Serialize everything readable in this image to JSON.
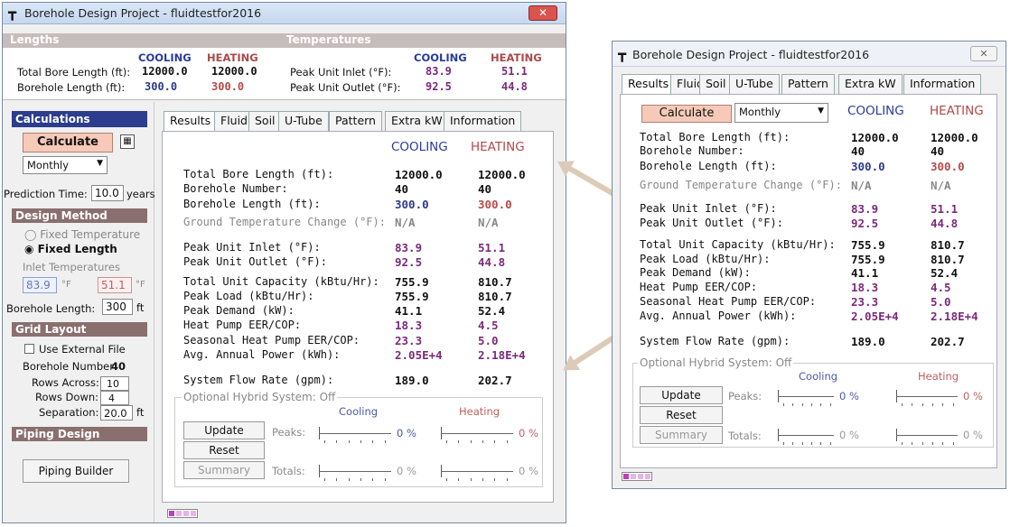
{
  "left": {
    "title": "Borehole Design Project - fluidtestfor2016",
    "lengths_header": "Lengths",
    "temps_header": "Temperatures",
    "cooling": "COOLING",
    "heating": "HEATING",
    "lengths": [
      {
        "label": "Total Bore Length (ft):",
        "cool": "12000.0",
        "heat": "12000.0"
      },
      {
        "label": "Borehole Length (ft):",
        "cool": "300.0",
        "heat": "300.0"
      }
    ],
    "temps": [
      {
        "label": "Peak Unit Inlet (°F):",
        "cool": "83.9",
        "heat": "51.1"
      },
      {
        "label": "Peak Unit Outlet (°F):",
        "cool": "92.5",
        "heat": "44.8"
      }
    ],
    "calc_header": "Calculations",
    "calculate": "Calculate",
    "period": "Monthly",
    "prediction_label": "Prediction Time:",
    "prediction_value": "10.0",
    "prediction_unit": "years",
    "design_header": "Design Method",
    "fixed_temp": "Fixed Temperature",
    "fixed_length": "Fixed Length",
    "inlet_label": "Inlet Temperatures",
    "inlet_cool": "83.9",
    "inlet_heat": "51.1",
    "unit_f": "°F",
    "bore_len_label": "Borehole Length:",
    "bore_len_value": "300",
    "ft": "ft",
    "grid_header": "Grid Layout",
    "use_external": "Use External File",
    "bore_num_label": "Borehole Number:",
    "bore_num_value": "40",
    "rows_across_label": "Rows Across:",
    "rows_across_value": "10",
    "rows_down_label": "Rows Down:",
    "rows_down_value": "4",
    "separation_label": "Separation:",
    "separation_value": "20.0",
    "piping_header": "Piping Design",
    "piping_builder": "Piping Builder"
  },
  "tabs": [
    "Results",
    "Fluid",
    "Soil",
    "U-Tube",
    "Pattern",
    "Extra kW",
    "Information"
  ],
  "results": [
    {
      "label": "Total Bore Length (ft):",
      "cool": "12000.0",
      "heat": "12000.0",
      "cc": "vk",
      "hc": "vk"
    },
    {
      "label": "Borehole Number:",
      "cool": "40",
      "heat": "40",
      "cc": "vk",
      "hc": "vk"
    },
    {
      "label": "Borehole Length (ft):",
      "cool": "300.0",
      "heat": "300.0",
      "cc": "vb",
      "hc": "vr"
    },
    {
      "label": "Ground Temperature Change (°F):",
      "cool": "N/A",
      "heat": "N/A",
      "cc": "vg",
      "hc": "vg",
      "grey": true
    },
    {
      "label": "Peak Unit Inlet (°F):",
      "cool": "83.9",
      "heat": "51.1",
      "cc": "vp",
      "hc": "vp"
    },
    {
      "label": "Peak Unit Outlet (°F):",
      "cool": "92.5",
      "heat": "44.8",
      "cc": "vp",
      "hc": "vp"
    },
    {
      "label": "Total Unit Capacity (kBtu/Hr):",
      "cool": "755.9",
      "heat": "810.7",
      "cc": "vk",
      "hc": "vk"
    },
    {
      "label": "Peak Load (kBtu/Hr):",
      "cool": "755.9",
      "heat": "810.7",
      "cc": "vk",
      "hc": "vk"
    },
    {
      "label": "Peak Demand (kW):",
      "cool": "41.1",
      "heat": "52.4",
      "cc": "vk",
      "hc": "vk"
    },
    {
      "label": "Heat Pump EER/COP:",
      "cool": "18.3",
      "heat": "4.5",
      "cc": "vp",
      "hc": "vp"
    },
    {
      "label": "Seasonal Heat Pump EER/COP:",
      "cool": "23.3",
      "heat": "5.0",
      "cc": "vp",
      "hc": "vp"
    },
    {
      "label": "Avg. Annual Power (kWh):",
      "cool": "2.05E+4",
      "heat": "2.18E+4",
      "cc": "vp",
      "hc": "vp"
    },
    {
      "label": "System Flow Rate (gpm):",
      "cool": "189.0",
      "heat": "202.7",
      "cc": "vk",
      "hc": "vk"
    }
  ],
  "hybrid": {
    "title": "Optional Hybrid System: Off",
    "cooling": "Cooling",
    "heating": "Heating",
    "update": "Update",
    "reset": "Reset",
    "summary": "Summary",
    "peaks": "Peaks:",
    "totals": "Totals:",
    "pct": "0 %"
  },
  "right": {
    "title": "Borehole Design Project - fluidtestfor2016",
    "calculate": "Calculate",
    "period": "Monthly",
    "cooling": "COOLING",
    "heating": "HEATING"
  },
  "progress": {
    "filled_cells": 1,
    "total_cells": 4
  }
}
